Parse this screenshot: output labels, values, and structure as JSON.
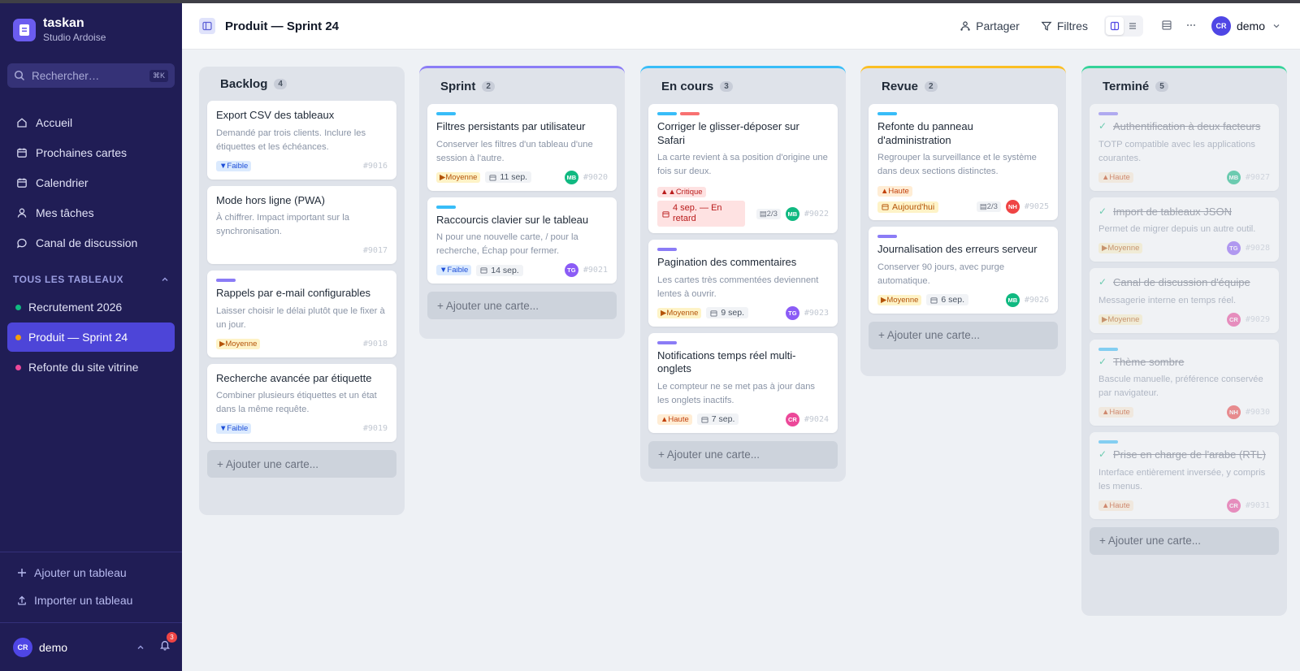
{
  "app": {
    "name": "taskan",
    "subtitle": "Studio Ardoise"
  },
  "search": {
    "placeholder": "Rechercher…",
    "shortcut": "⌘K"
  },
  "nav": [
    {
      "label": "Accueil",
      "icon": "home-icon"
    },
    {
      "label": "Prochaines cartes",
      "icon": "calendar-icon"
    },
    {
      "label": "Calendrier",
      "icon": "calendar-icon"
    },
    {
      "label": "Mes tâches",
      "icon": "user-icon"
    },
    {
      "label": "Canal de discussion",
      "icon": "chat-icon"
    }
  ],
  "boards_section": "TOUS LES TABLEAUX",
  "boards": [
    {
      "label": "Recrutement 2026",
      "color": "#10b981"
    },
    {
      "label": "Produit — Sprint 24",
      "color": "#f59e0b"
    },
    {
      "label": "Refonte du site vitrine",
      "color": "#ec4899"
    }
  ],
  "sidebar_actions": {
    "add_board": "Ajouter un tableau",
    "import_board": "Importer un tableau"
  },
  "user": {
    "initials": "CR",
    "name": "demo",
    "notifications": "3"
  },
  "header": {
    "title": "Produit — Sprint 24",
    "share": "Partager",
    "filters": "Filtres",
    "user_initials": "CR",
    "user_name": "demo"
  },
  "add_card_label": "+ Ajouter une carte...",
  "columns": [
    {
      "name": "Backlog",
      "count": "4",
      "accent": "",
      "cards": [
        {
          "title": "Export CSV des tableaux",
          "desc": "Demandé par trois clients. Inclure les étiquettes et les échéances.",
          "priority": "Faible",
          "id": "#9016"
        },
        {
          "title": "Mode hors ligne (PWA)",
          "desc": "À chiffrer. Impact important sur la synchronisation.",
          "id": "#9017"
        },
        {
          "title": "Rappels par e-mail configurables",
          "desc": "Laisser choisir le délai plutôt que le fixer à un jour.",
          "priority": "Moyenne",
          "id": "#9018"
        },
        {
          "title": "Recherche avancée par étiquette",
          "desc": "Combiner plusieurs étiquettes et un état dans la même requête.",
          "priority": "Faible",
          "id": "#9019"
        }
      ]
    },
    {
      "name": "Sprint",
      "count": "2",
      "accent": "#8b7cf6",
      "cards": [
        {
          "title": "Filtres persistants par utilisateur",
          "desc": "Conserver les filtres d'un tableau d'une session à l'autre.",
          "priority": "Moyenne",
          "date": "11 sep.",
          "assignee": "MB",
          "id": "#9020"
        },
        {
          "title": "Raccourcis clavier sur le tableau",
          "desc": "N pour une nouvelle carte, / pour la recherche, Échap pour fermer.",
          "priority": "Faible",
          "date": "14 sep.",
          "assignee": "TG",
          "id": "#9021"
        }
      ]
    },
    {
      "name": "En cours",
      "count": "3",
      "accent": "#38bdf8",
      "cards": [
        {
          "title": "Corriger le glisser-déposer sur Safari",
          "desc": "La carte revient à sa position d'origine une fois sur deux.",
          "priority": "Critique",
          "date": "4 sep. — En retard",
          "subtasks": "2/3",
          "assignee": "MB",
          "id": "#9022"
        },
        {
          "title": "Pagination des commentaires",
          "desc": "Les cartes très commentées deviennent lentes à ouvrir.",
          "priority": "Moyenne",
          "date": "9 sep.",
          "assignee": "TG",
          "id": "#9023"
        },
        {
          "title": "Notifications temps réel multi-onglets",
          "desc": "Le compteur ne se met pas à jour dans les onglets inactifs.",
          "priority": "Haute",
          "date": "7 sep.",
          "assignee": "CR",
          "id": "#9024"
        }
      ]
    },
    {
      "name": "Revue",
      "count": "2",
      "accent": "#fbbf24",
      "cards": [
        {
          "title": "Refonte du panneau d'administration",
          "desc": "Regrouper la surveillance et le système dans deux sections distinctes.",
          "priority": "Haute",
          "date": "Aujourd'hui",
          "subtasks": "2/3",
          "assignee": "NH",
          "id": "#9025"
        },
        {
          "title": "Journalisation des erreurs serveur",
          "desc": "Conserver 90 jours, avec purge automatique.",
          "priority": "Moyenne",
          "date": "6 sep.",
          "assignee": "MB",
          "id": "#9026"
        }
      ]
    },
    {
      "name": "Terminé",
      "count": "5",
      "accent": "#34d399",
      "cards": [
        {
          "title": "Authentification à deux facteurs",
          "desc": "TOTP compatible avec les applications courantes.",
          "priority": "Haute",
          "assignee": "MB",
          "id": "#9027"
        },
        {
          "title": "Import de tableaux JSON",
          "desc": "Permet de migrer depuis un autre outil.",
          "priority": "Moyenne",
          "assignee": "TG",
          "id": "#9028"
        },
        {
          "title": "Canal de discussion d'équipe",
          "desc": "Messagerie interne en temps réel.",
          "priority": "Moyenne",
          "assignee": "CR",
          "id": "#9029"
        },
        {
          "title": "Thème sombre",
          "desc": "Bascule manuelle, préférence conservée par navigateur.",
          "priority": "Haute",
          "assignee": "NH",
          "id": "#9030"
        },
        {
          "title": "Prise en charge de l'arabe (RTL)",
          "desc": "Interface entièrement inversée, y compris les menus.",
          "priority": "Haute",
          "assignee": "CR",
          "id": "#9031"
        }
      ]
    }
  ],
  "colors": {
    "sidebar": "#201d55",
    "accent": "#4f46e5",
    "label_violet": "#8b7cf6",
    "label_blue": "#38bdf8",
    "label_red": "#f87171"
  }
}
